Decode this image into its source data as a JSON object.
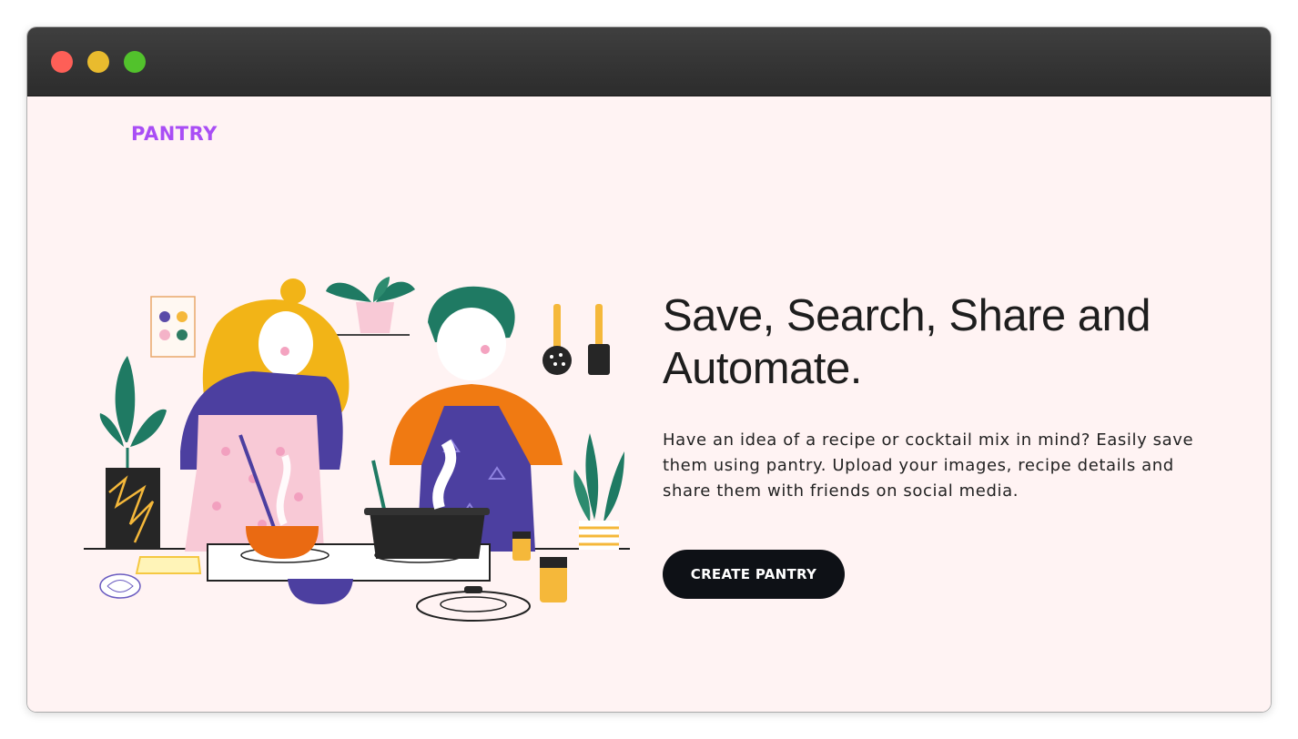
{
  "window": {
    "controls": {
      "close_color": "#fe5f57",
      "minimize_color": "#e9bb2e",
      "maximize_color": "#52c22c"
    }
  },
  "header": {
    "logo_text": "PANTRY",
    "logo_color": "#a94ef5"
  },
  "hero": {
    "headline": "Save, Search, Share and Automate.",
    "description": "Have an idea of a recipe or cocktail mix in mind? Easily save them using pantry. Upload your images, recipe details and share them with friends on social media.",
    "cta_label": "CREATE PANTRY",
    "illustration": "two-people-cooking-illustration"
  },
  "colors": {
    "background": "#fff3f3",
    "cta_background": "#0e1116",
    "text_dark": "#1e1e1e"
  }
}
